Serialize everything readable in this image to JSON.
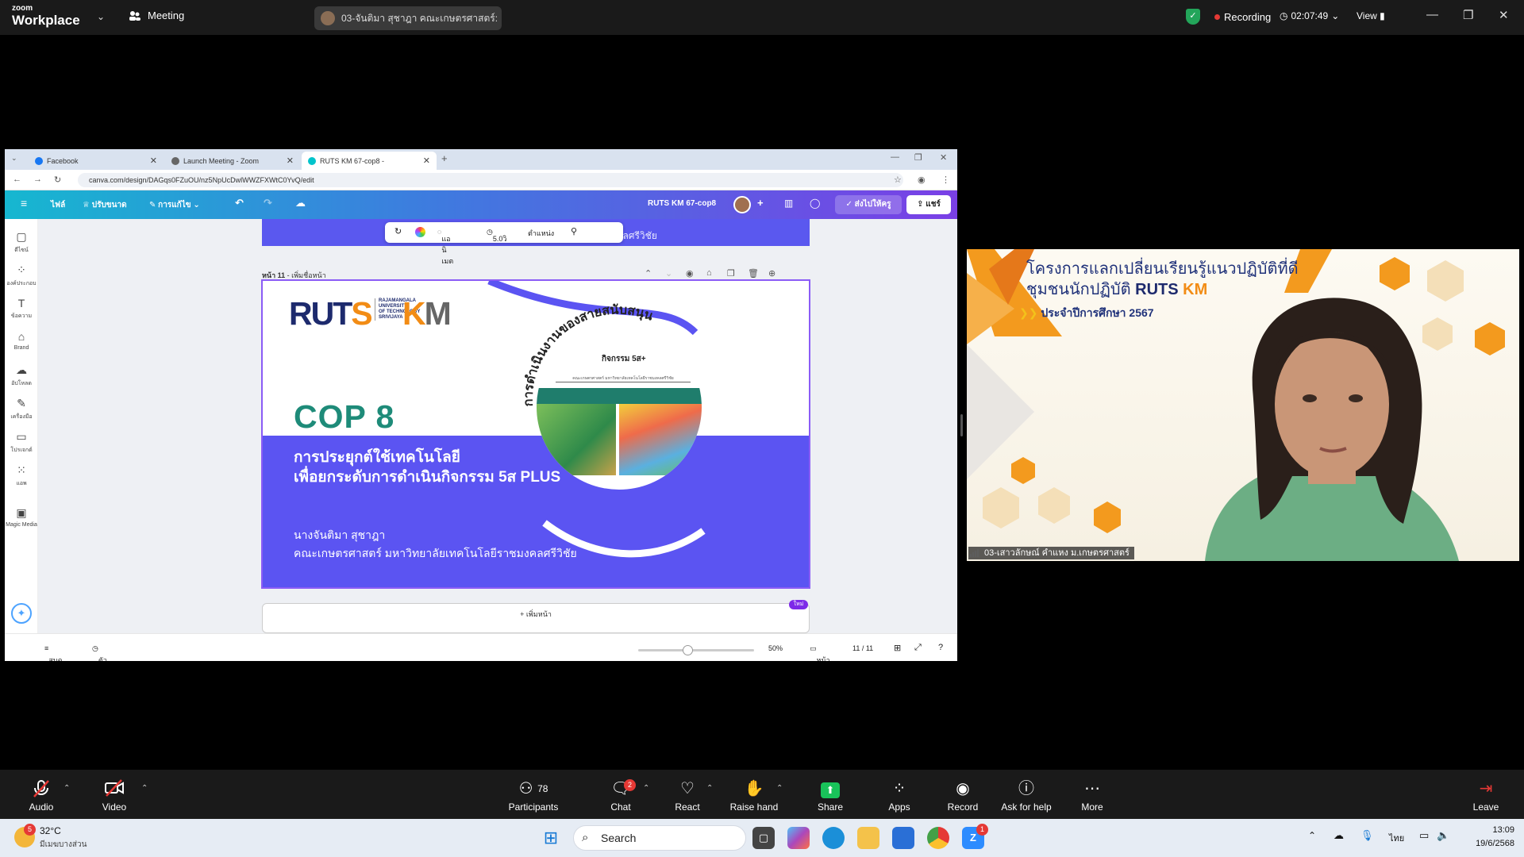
{
  "zoom": {
    "brand_small": "zoom",
    "brand_big": "Workplace",
    "meeting_menu": "Meeting",
    "share_title": "03-จันติมา สุชาฎา คณะเกษตรศาสตร์:",
    "recording_label": "Recording",
    "elapsed": "02:07:49",
    "view_label": "View",
    "toolbar": {
      "audio": "Audio",
      "video": "Video",
      "participants": "Participants",
      "participants_count": "78",
      "chat": "Chat",
      "chat_badge": "2",
      "react": "React",
      "raise_hand": "Raise hand",
      "share": "Share",
      "apps": "Apps",
      "record": "Record",
      "ask_help": "Ask for help",
      "more": "More",
      "leave": "Leave"
    },
    "participant_name": "03-เสาวลักษณ์ คำแหง ม.เกษตรศาสตร์"
  },
  "browser": {
    "tabs": [
      {
        "title": "Facebook",
        "color": "#1877f2"
      },
      {
        "title": "Launch Meeting - Zoom",
        "color": "#666666"
      },
      {
        "title": "RUTS KM 67-cop8 - ",
        "color": "#00c4cc"
      }
    ],
    "url": "canva.com/design/DAGqs0FZuOU/nz5NpUcDwlWWZFXWtC0YvQ/edit"
  },
  "canva": {
    "menu": {
      "file": "ไฟล์",
      "resize": "ปรับขนาด",
      "editing": "การแก้ไข"
    },
    "doc_title": "RUTS KM 67-cop8",
    "present": "ส่งไปให้ครู",
    "share": "แชร์",
    "rail": [
      {
        "label": "ดีไซน์",
        "icon": "▢"
      },
      {
        "label": "องค์ประกอบ",
        "icon": "⁘"
      },
      {
        "label": "ข้อความ",
        "icon": "T"
      },
      {
        "label": "Brand",
        "icon": "⌂"
      },
      {
        "label": "อัปโหลด",
        "icon": "☁"
      },
      {
        "label": "เครื่องมือ",
        "icon": "✎"
      },
      {
        "label": "โปรเจกต์",
        "icon": "▭"
      },
      {
        "label": "แอพ",
        "icon": "⁙"
      },
      {
        "label": "Magic Media",
        "icon": "▣"
      }
    ],
    "prev_slide_text": "คณะเกษตรศาสตร์ มหาวิทยาลัยเทคโนโลยีราชมงคลศรีวิชัย",
    "floatbar": {
      "animate": "แอนิเมต",
      "duration": "5.0วิ",
      "position": "ตำแหน่ง"
    },
    "page_label": "หน้า 11",
    "page_name_hint": "- เพิ่มชื่อหน้า",
    "add_page": "+ เพิ่มหน้า",
    "new_badge": "ใหม่",
    "status": {
      "notes": "สมุดโน้ต",
      "timer": "ตัวจับเวลา",
      "zoom": "50%",
      "pages_label": "หน้า",
      "pages": "11 / 11"
    }
  },
  "slide": {
    "logo_ruts_1": "RUT",
    "logo_ruts_2": "S",
    "logo_uni": "RAJAMANGALA\nUNIVERSITY\nOF TECHNOLOGY\nSRIVIJAYA",
    "logo_km_1": "K",
    "logo_km_2": "M",
    "cop": "COP 8",
    "title1": "การประยุกต์ใช้เทคโนโลยี",
    "title2": "เพื่อยกระดับการดำเนินกิจกรรม 5ส PLUS",
    "name": "นางจันติมา สุชาฎา",
    "faculty": "คณะเกษตรศาสตร์ มหาวิทยาลัยเทคโนโลยีราชมงคลศรีวิชัย",
    "arc_text": "การดำเนินงานของสายสนับสนุน",
    "circle_title": "กิจกรรม 5ส+",
    "circle_sub": "คณะเกษตรศาสตร์ มหาวิทยาลัยเทคโนโลยีราชมงคลศรีวิชัย"
  },
  "video_bg": {
    "line1": "โครงการแลกเปลี่ยนเรียนรู้แนวปฏิบัติที่ดี",
    "line2": "ชุมชนนักปฏิบัติ",
    "line2_ruts": "RUTS",
    "line2_km": "KM",
    "line3": "ประจำปีการศึกษา 2567"
  },
  "taskbar": {
    "temp": "32°C",
    "weather": "มีเมฆบางส่วน",
    "weather_badge": "5",
    "search": "Search",
    "lang": "ไทย",
    "time": "13:09",
    "date": "19/6/2568",
    "zoom_badge": "1"
  }
}
